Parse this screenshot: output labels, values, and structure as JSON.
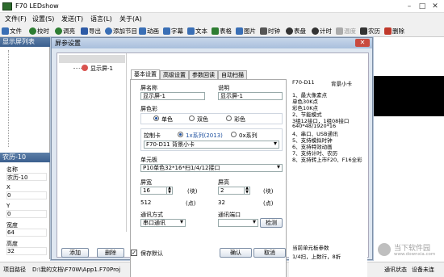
{
  "app": {
    "title": "F70 LEDshow"
  },
  "window_controls": {
    "minimize": "–",
    "maximize": "□",
    "close": "✕"
  },
  "menu": [
    "文件(F)",
    "设置(S)",
    "发送(T)",
    "语言(L)",
    "关于(A)"
  ],
  "toolbar": [
    {
      "label": "文件",
      "icon": "file-icon",
      "color": "#3a6fb5"
    },
    {
      "label": "校时",
      "icon": "clock-sync-icon",
      "color": "#2e7d32"
    },
    {
      "label": "调亮",
      "icon": "brightness-icon",
      "color": "#2e7d32"
    },
    {
      "label": "导出",
      "icon": "export-icon",
      "color": "#2e5ba6"
    },
    {
      "label": "添加节目",
      "icon": "add-program-icon",
      "color": "#3a6fb5"
    },
    {
      "label": "动画",
      "icon": "animation-icon",
      "color": "#3a6fb5"
    },
    {
      "label": "字幕",
      "icon": "subtitle-icon",
      "color": "#3a6fb5"
    },
    {
      "label": "文本",
      "icon": "text-icon",
      "color": "#3a6fb5"
    },
    {
      "label": "表格",
      "icon": "table-icon",
      "color": "#2e7d32"
    },
    {
      "label": "图片",
      "icon": "picture-icon",
      "color": "#3a6fb5"
    },
    {
      "label": "时钟",
      "icon": "clock-icon",
      "color": "#555"
    },
    {
      "label": "表盘",
      "icon": "dial-icon",
      "color": "#333"
    },
    {
      "label": "计时",
      "icon": "timer-icon",
      "color": "#333"
    },
    {
      "label": "温度",
      "icon": "temperature-icon",
      "color": "#aaa"
    },
    {
      "label": "农历",
      "icon": "lunar-calendar-icon",
      "color": "#333"
    },
    {
      "label": "删除",
      "icon": "delete-icon",
      "color": "#c0392b"
    }
  ],
  "left": {
    "screen_list_title": "显示屏列表",
    "props_title": "农历-10",
    "props": [
      {
        "label": "名称",
        "value": "农历-10"
      },
      {
        "label": "X",
        "value": "0"
      },
      {
        "label": "Y",
        "value": "0"
      },
      {
        "label": "宽度",
        "value": "64"
      },
      {
        "label": "高度",
        "value": "32"
      }
    ]
  },
  "status": {
    "path_label": "项目路径",
    "path": "D:\\我的文档\\F70W\\App1.F70Proj",
    "comm_status": "通讯状态",
    "device_status": "设备未连"
  },
  "dialog": {
    "title": "屏参设置",
    "close": "✕",
    "tree_item": "显示屏-1",
    "tabs": [
      "基本设置",
      "高级设置",
      "参数回读",
      "自动扫描"
    ],
    "name_label": "屏名称",
    "name_value": "显示屏-1",
    "desc_label": "说明",
    "desc_value": "显示屏-1",
    "color_label": "屏色彩",
    "colors": [
      "单色",
      "双色",
      "彩色"
    ],
    "controller_label": "控制卡",
    "series": [
      "1x系列(2013)",
      "0x系列"
    ],
    "controller_value": "F70-D11    背景小卡",
    "unit_label": "单元板",
    "unit_value": "P10单色32*16*扫1/4/12接口",
    "width_label": "屏宽",
    "width_value": "16",
    "width_unit": "(块)",
    "width_pixels": "512",
    "width_pixel_unit": "(点)",
    "height_label": "屏高",
    "height_value": "2",
    "height_unit": "(块)",
    "height_pixels": "32",
    "height_pixel_unit": "(点)",
    "comm_mode_label": "通讯方式",
    "comm_mode_value": "串口通讯",
    "comm_port_label": "通讯端口",
    "detect_button": "检测",
    "add_button": "添加",
    "delete_button": "删除",
    "save_default": "保存默认",
    "ok_button": "确认",
    "cancel_button": "取消",
    "desc_pane": {
      "model": "F70-D11",
      "model_name": "背景小卡",
      "features": [
        "1、最大像素点",
        "单色30K点",
        "彩色10K点",
        "2、节能模式",
        "3组12接口，1组08接口",
        "640*48/1920*16",
        "4、串口、USB通讯",
        "5、支持模拟时钟",
        "6、支持特效动画",
        "7、支持计时、农历",
        "8、支持转上市F20、F16全彩"
      ],
      "unit_params_label": "当前单元板参数",
      "unit_params_value": "1/4扫，上数行，8折"
    }
  },
  "watermark": {
    "text": "当下软件园",
    "sub": "www.downxia.com"
  },
  "colors": {
    "dialog_bg": "#dfe7f1",
    "header_blue": "#3b5f8e",
    "accent": "#1d4f9e"
  }
}
